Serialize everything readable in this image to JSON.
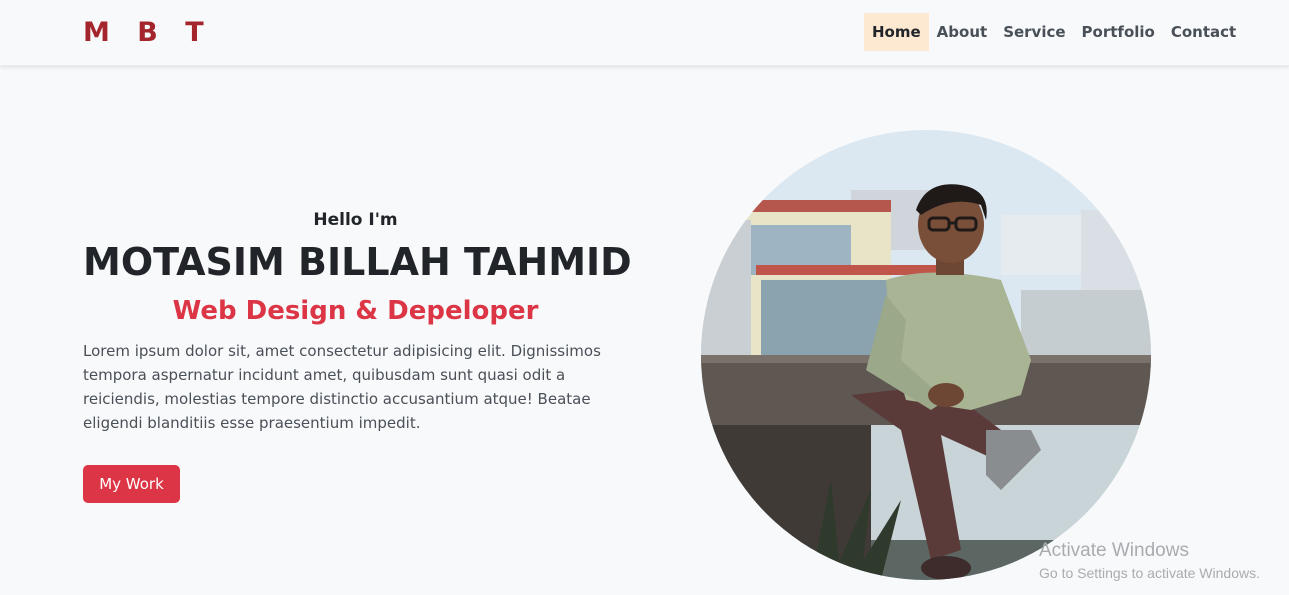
{
  "nav": {
    "brand": "M B T",
    "links": [
      {
        "label": "Home"
      },
      {
        "label": "About"
      },
      {
        "label": "Service"
      },
      {
        "label": "Portfolio"
      },
      {
        "label": "Contact"
      }
    ]
  },
  "hero": {
    "greeting": "Hello I'm",
    "name": "MOTASIM BILLAH TAHMID",
    "role": "Web Design & Depeloper",
    "description": "Lorem ipsum dolor sit, amet consectetur adipisicing elit. Dignissimos tempora aspernatur incidunt amet, quibusdam sunt quasi odit a reiciendis, molestias tempore distinctio accusantium atque! Beatae eligendi blanditiis esse praesentium impedit.",
    "button_label": "My Work"
  },
  "watermark": {
    "title": "Activate Windows",
    "subtitle": "Go to Settings to activate Windows."
  },
  "colors": {
    "brand": "#a4262c",
    "accent": "#dc3545",
    "active_nav_bg": "#fde9d2"
  }
}
